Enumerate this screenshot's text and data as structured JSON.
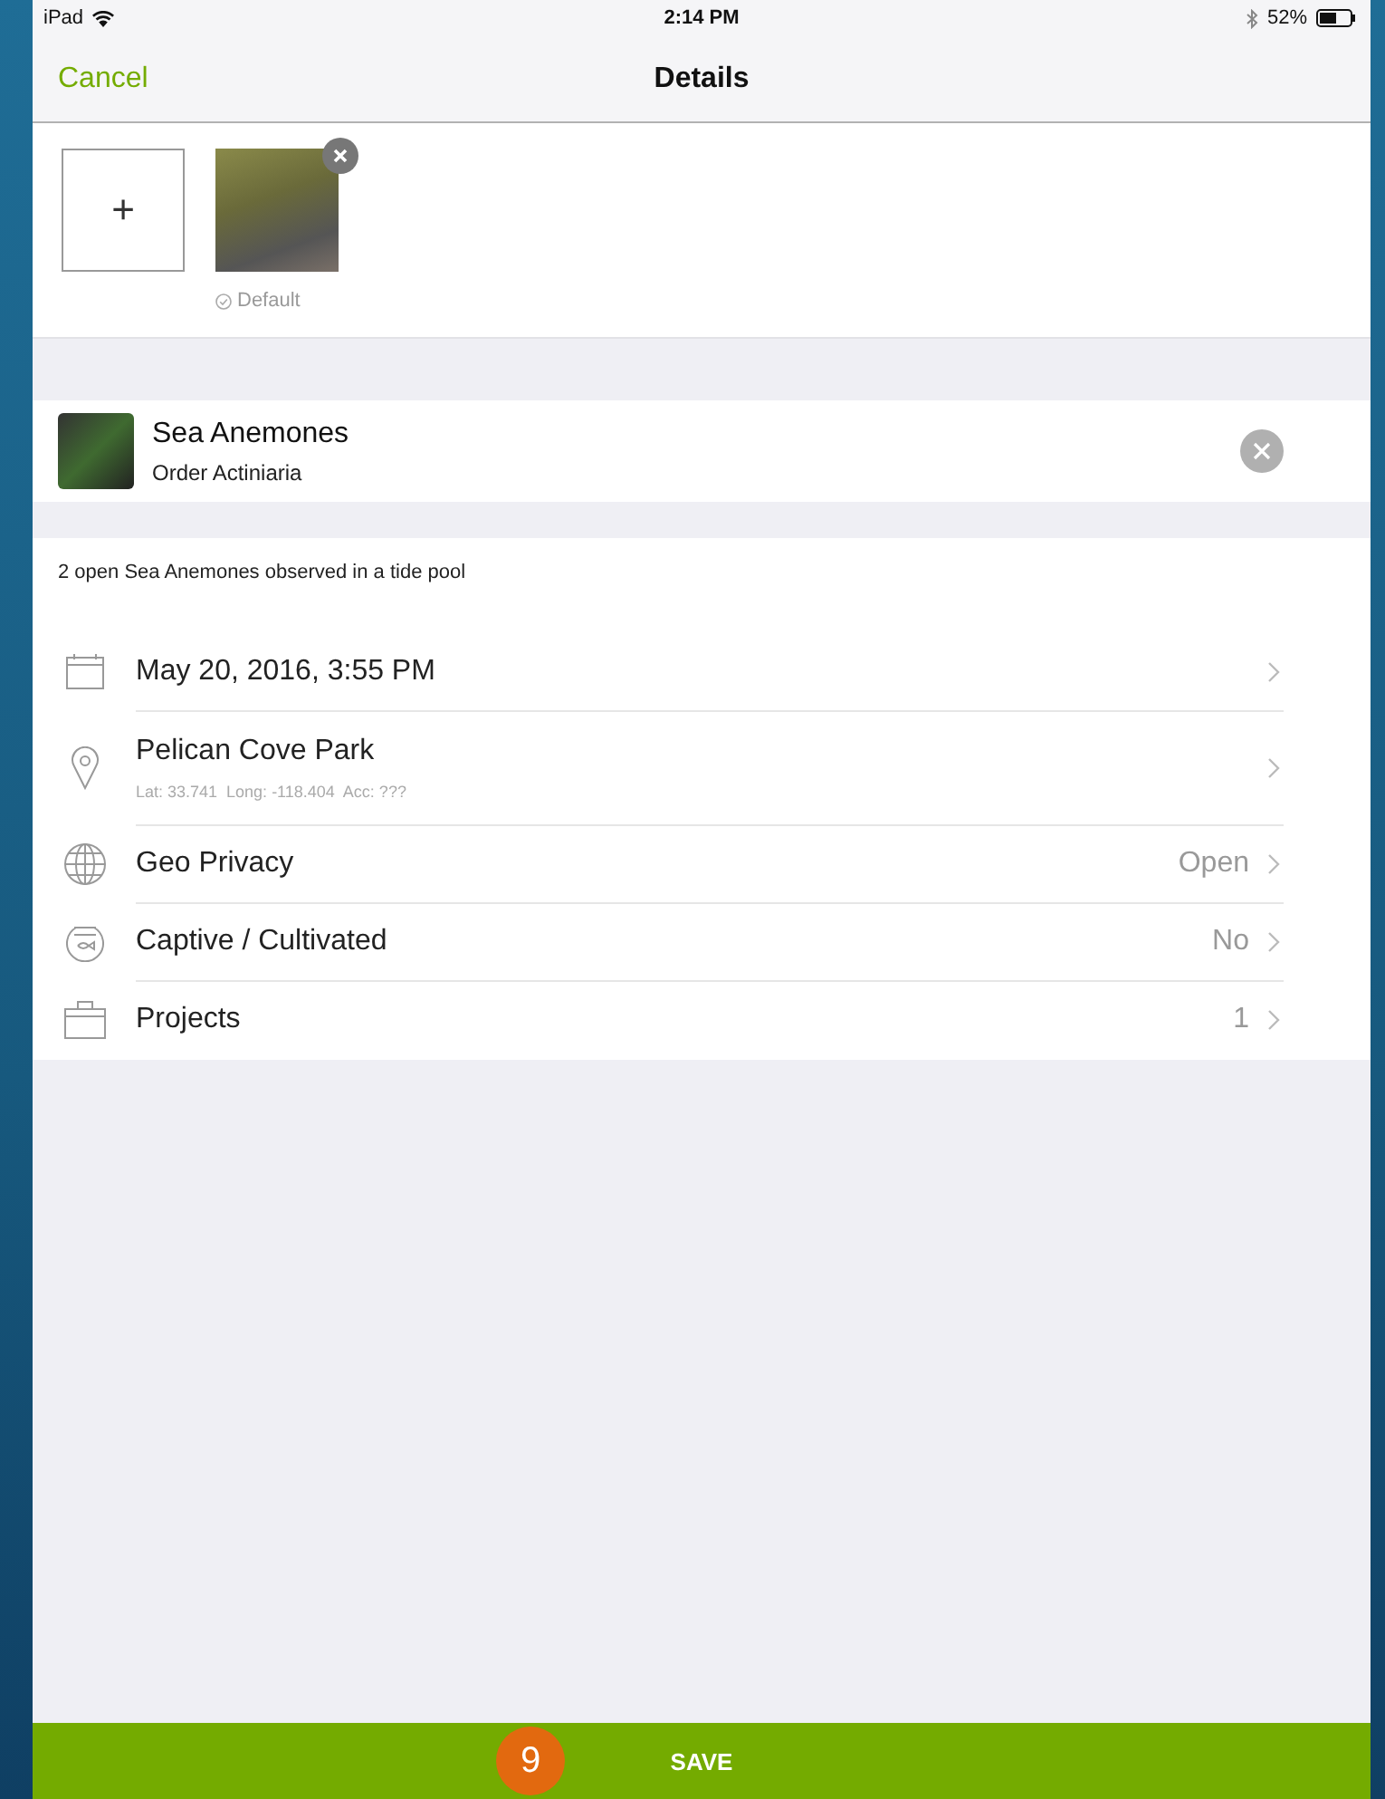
{
  "status_bar": {
    "device": "iPad",
    "time": "2:14 PM",
    "battery": "52%"
  },
  "nav": {
    "cancel": "Cancel",
    "title": "Details"
  },
  "photos": {
    "add": "+",
    "default_label": "Default"
  },
  "taxon": {
    "name": "Sea Anemones",
    "rank": "Order Actiniaria"
  },
  "notes": "2 open Sea Anemones observed in a tide pool",
  "rows": [
    {
      "kind": "date",
      "label": "May 20, 2016, 3:55 PM"
    },
    {
      "kind": "location",
      "label": "Pelican Cove Park",
      "sublabel": "Lat: 33.741  Long: -118.404  Acc: ???"
    },
    {
      "kind": "globe",
      "label": "Geo Privacy",
      "value": "Open"
    },
    {
      "kind": "fishbowl",
      "label": "Captive / Cultivated",
      "value": "No"
    },
    {
      "kind": "briefcase",
      "label": "Projects",
      "value": "1"
    }
  ],
  "save": {
    "label": "SAVE",
    "badge": "9"
  }
}
